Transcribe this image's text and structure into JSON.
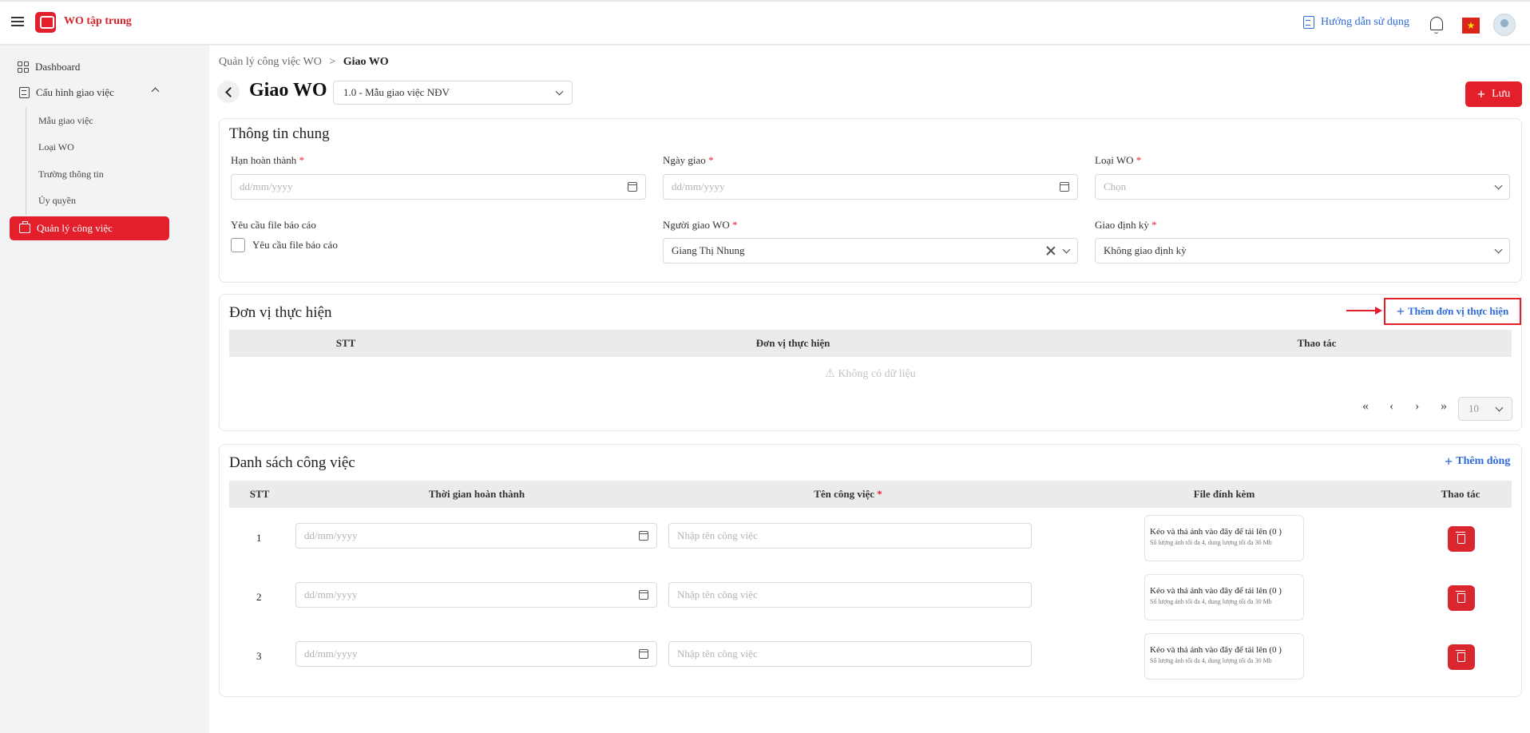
{
  "header": {
    "app_title": "WO tập trung",
    "guide_label": "Hướng dẫn sử dụng",
    "flag_glyph": "★"
  },
  "sidebar": {
    "dashboard": "Dashboard",
    "config_group": "Cấu hình giao việc",
    "sub_items": [
      "Mẫu giao việc",
      "Loại WO",
      "Trường thông tin",
      "Ủy quyền"
    ],
    "active_item": "Quản lý công việc"
  },
  "breadcrumb": {
    "parent": "Quản lý công việc WO",
    "separator": ">",
    "current": "Giao WO"
  },
  "page": {
    "title": "Giao WO",
    "template_value": "1.0 - Mẫu giao việc NĐV",
    "save_label": "Lưu",
    "plus_glyph": "+"
  },
  "general_info": {
    "title": "Thông tin chung",
    "required_mark": "*",
    "deadline_label": "Hạn hoàn thành",
    "deadline_placeholder": "dd/mm/yyyy",
    "assign_date_label": "Ngày giao",
    "assign_date_placeholder": "dd/mm/yyyy",
    "wo_type_label": "Loại WO",
    "wo_type_placeholder": "Chọn",
    "report_file_label": "Yêu cầu file báo cáo",
    "report_file_checkbox_label": "Yêu cầu file báo cáo",
    "assigner_label": "Người giao WO",
    "assigner_value": "Giang Thị Nhung",
    "periodic_label": "Giao định kỳ",
    "periodic_value": "Không giao định kỳ"
  },
  "units": {
    "title": "Đơn vị thực hiện",
    "add_label": "Thêm đơn vị thực hiện",
    "columns": [
      "STT",
      "Đơn vị thực hiện",
      "Thao tác"
    ],
    "empty_text": "⚠ Không có dữ liệu",
    "pager": {
      "first": "«",
      "prev": "‹",
      "next": "›",
      "last": "»",
      "page_size": "10"
    }
  },
  "tasks": {
    "title": "Danh sách công việc",
    "add_label": "Thêm dòng",
    "columns": [
      "STT",
      "Thời gian hoàn thành",
      "Tên công việc",
      "File đính kèm",
      "Thao tác"
    ],
    "required_mark": "*",
    "date_placeholder": "dd/mm/yyyy",
    "name_placeholder": "Nhập tên công việc",
    "upload_title": "Kéo và thả ảnh vào đây để tải lên (0 )",
    "upload_hint": "Số lượng ảnh tối đa 4, dung lượng tối đa 30 Mb",
    "rows": [
      "1",
      "2",
      "3"
    ]
  }
}
